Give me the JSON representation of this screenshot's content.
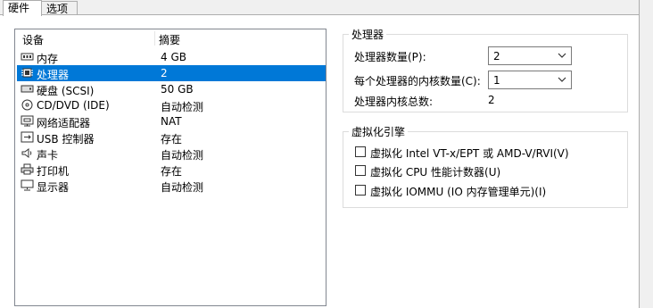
{
  "tabs": [
    {
      "label": "硬件",
      "active": true
    },
    {
      "label": "选项",
      "active": false
    }
  ],
  "device_list": {
    "headers": {
      "device": "设备",
      "summary": "摘要"
    },
    "rows": [
      {
        "name": "内存",
        "value": "4 GB",
        "icon": "memory-icon"
      },
      {
        "name": "处理器",
        "value": "2",
        "icon": "cpu-icon",
        "selected": true
      },
      {
        "name": "硬盘 (SCSI)",
        "value": "50 GB",
        "icon": "hard-disk-icon"
      },
      {
        "name": "CD/DVD (IDE)",
        "value": "自动检测",
        "icon": "cd-dvd-icon"
      },
      {
        "name": "网络适配器",
        "value": "NAT",
        "icon": "network-adapter-icon"
      },
      {
        "name": "USB 控制器",
        "value": "存在",
        "icon": "usb-icon"
      },
      {
        "name": "声卡",
        "value": "自动检测",
        "icon": "speaker-icon"
      },
      {
        "name": "打印机",
        "value": "存在",
        "icon": "printer-icon"
      },
      {
        "name": "显示器",
        "value": "自动检测",
        "icon": "monitor-icon"
      }
    ]
  },
  "processor": {
    "title": "处理器",
    "count_label": "处理器数量(P):",
    "count_value": "2",
    "cores_label": "每个处理器的内核数量(C):",
    "cores_value": "1",
    "total_label": "处理器内核总数:",
    "total_value": "2"
  },
  "virtualization": {
    "title": "虚拟化引擎",
    "options": [
      {
        "label": "虚拟化 Intel VT-x/EPT 或 AMD-V/RVI(V)",
        "checked": false
      },
      {
        "label": "虚拟化 CPU 性能计数器(U)",
        "checked": false
      },
      {
        "label": "虚拟化 IOMMU (IO 内存管理单元)(I)",
        "checked": false
      }
    ]
  },
  "colors": {
    "selection": "#0078d7",
    "panel": "#ffffff",
    "chrome": "#f0f0f0"
  }
}
